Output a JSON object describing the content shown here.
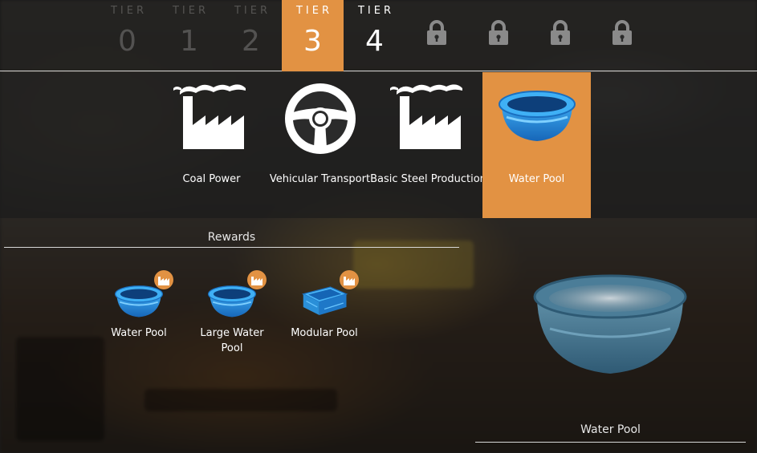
{
  "tiers": [
    {
      "label": "TIER",
      "number": "0",
      "state": "dim"
    },
    {
      "label": "TIER",
      "number": "1",
      "state": "dim"
    },
    {
      "label": "TIER",
      "number": "2",
      "state": "dim"
    },
    {
      "label": "TIER",
      "number": "3",
      "state": "active"
    },
    {
      "label": "TIER",
      "number": "4",
      "state": "open"
    },
    {
      "state": "locked",
      "icon": "lock-icon"
    },
    {
      "state": "locked",
      "icon": "lock-icon"
    },
    {
      "state": "locked",
      "icon": "lock-icon"
    },
    {
      "state": "locked",
      "icon": "lock-icon"
    }
  ],
  "milestones": [
    {
      "name": "Coal Power",
      "icon": "factory-icon"
    },
    {
      "name": "Vehicular Transport",
      "icon": "steering-wheel-icon"
    },
    {
      "name": "Basic Steel Production",
      "icon": "factory-icon"
    },
    {
      "name": "Water Pool",
      "icon": "water-pool-icon",
      "selected": true
    }
  ],
  "rewards": {
    "title": "Rewards",
    "items": [
      {
        "name": "Water Pool",
        "icon": "water-pool-icon",
        "badge": "factory-badge-icon"
      },
      {
        "name": "Large Water Pool",
        "icon": "large-water-pool-icon",
        "badge": "factory-badge-icon"
      },
      {
        "name": "Modular Pool",
        "icon": "modular-pool-icon",
        "badge": "factory-badge-icon"
      }
    ]
  },
  "preview": {
    "title": "Water Pool"
  },
  "colors": {
    "accent": "#e29243",
    "pool_blue": "#2a8fd8"
  }
}
